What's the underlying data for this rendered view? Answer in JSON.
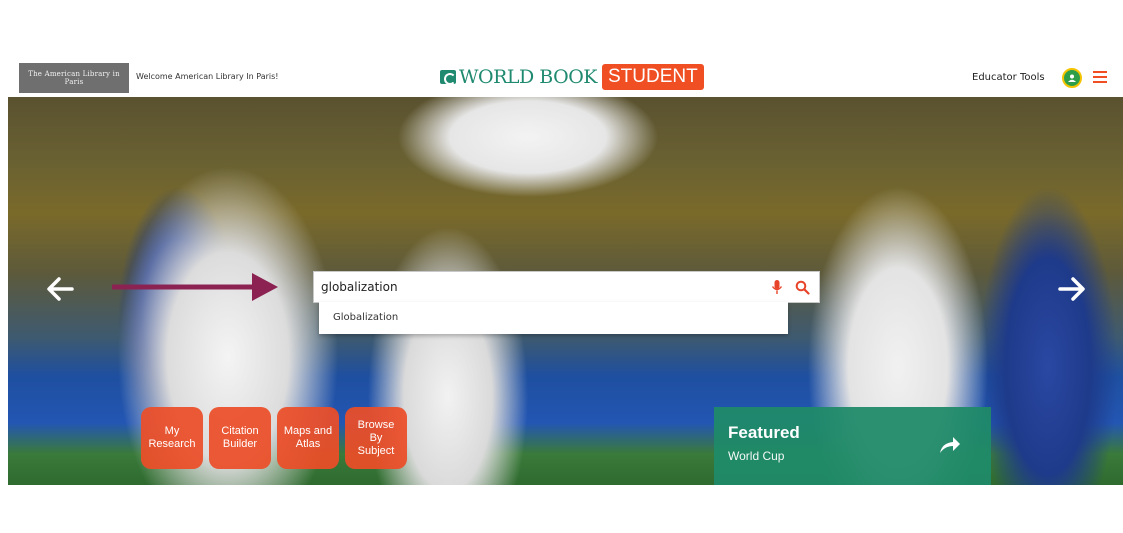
{
  "header": {
    "library_logo_text": "The American Library in Paris",
    "welcome_text": "Welcome American Library In Paris!",
    "brand_name": "WORLD BOOK",
    "brand_badge": "STUDENT",
    "educator_tools": "Educator Tools"
  },
  "search": {
    "value": "globalization",
    "suggestions": [
      "Globalization"
    ]
  },
  "quick_links": [
    {
      "label": "My\nResearch"
    },
    {
      "label": "Citation\nBuilder"
    },
    {
      "label": "Maps and\nAtlas"
    },
    {
      "label": "Browse\nBy\nSubject"
    }
  ],
  "featured": {
    "title": "Featured",
    "subtitle": "World Cup"
  },
  "icons": {
    "brand": "world-book-logo-icon",
    "user": "user-icon",
    "menu": "hamburger-menu-icon",
    "mic": "microphone-icon",
    "search": "search-icon",
    "prev": "arrow-left-icon",
    "next": "arrow-right-icon",
    "share": "share-arrow-icon"
  },
  "colors": {
    "brand_green": "#1f8a70",
    "brand_orange": "#f04e23",
    "tile_orange": "#ec4e28",
    "featured_green": "#1f8a68",
    "pointer_arrow": "#8b2252"
  }
}
